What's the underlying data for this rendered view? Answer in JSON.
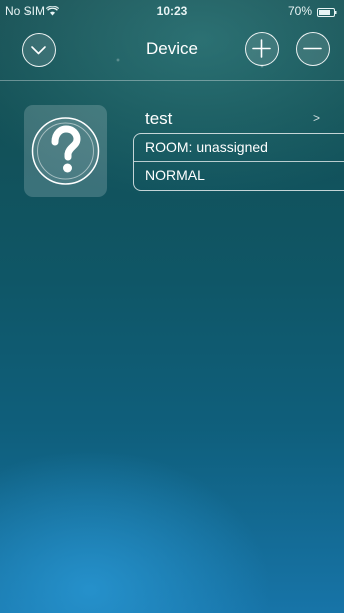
{
  "status_bar": {
    "carrier": "No SIM",
    "time": "10:23",
    "battery": "70%"
  },
  "nav": {
    "title": "Device",
    "left_icon": "chevron-down-icon",
    "right_icons": [
      "plus-icon",
      "minus-icon"
    ]
  },
  "devices": [
    {
      "name": "test",
      "room": "ROOM: unassigned",
      "state": "NORMAL",
      "icon": "question-mark-icon"
    }
  ],
  "colors": {
    "background_top": "#1a4f53",
    "background_bottom": "#1774a8",
    "foreground": "#ffffff"
  }
}
